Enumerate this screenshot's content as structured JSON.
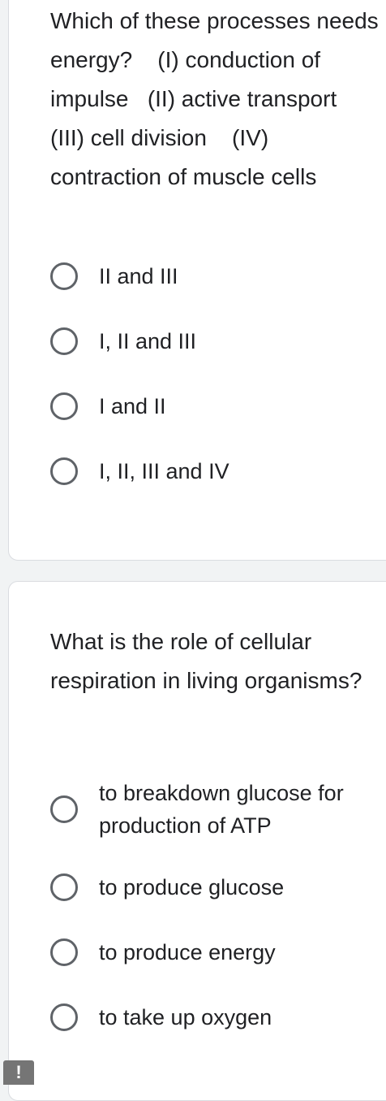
{
  "questions": [
    {
      "text": "Which of these processes needs energy?    (I) conduction of impulse   (II) active transport    (III) cell division    (IV) contraction of muscle cells",
      "options": [
        "II and III",
        "I, II and III",
        "I and II",
        "I, II, III and IV"
      ]
    },
    {
      "text": "What is the role of cellular respiration in living organisms?",
      "options": [
        "to breakdown glucose for production of ATP",
        "to produce glucose",
        "to produce energy",
        "to take up oxygen"
      ]
    }
  ],
  "badge": {
    "icon": "exclamation-icon",
    "glyph": "!"
  },
  "colors": {
    "card_background": "#ffffff",
    "page_background": "#f1f3f4",
    "radio_border": "#5f6368",
    "badge_background": "#757575"
  }
}
